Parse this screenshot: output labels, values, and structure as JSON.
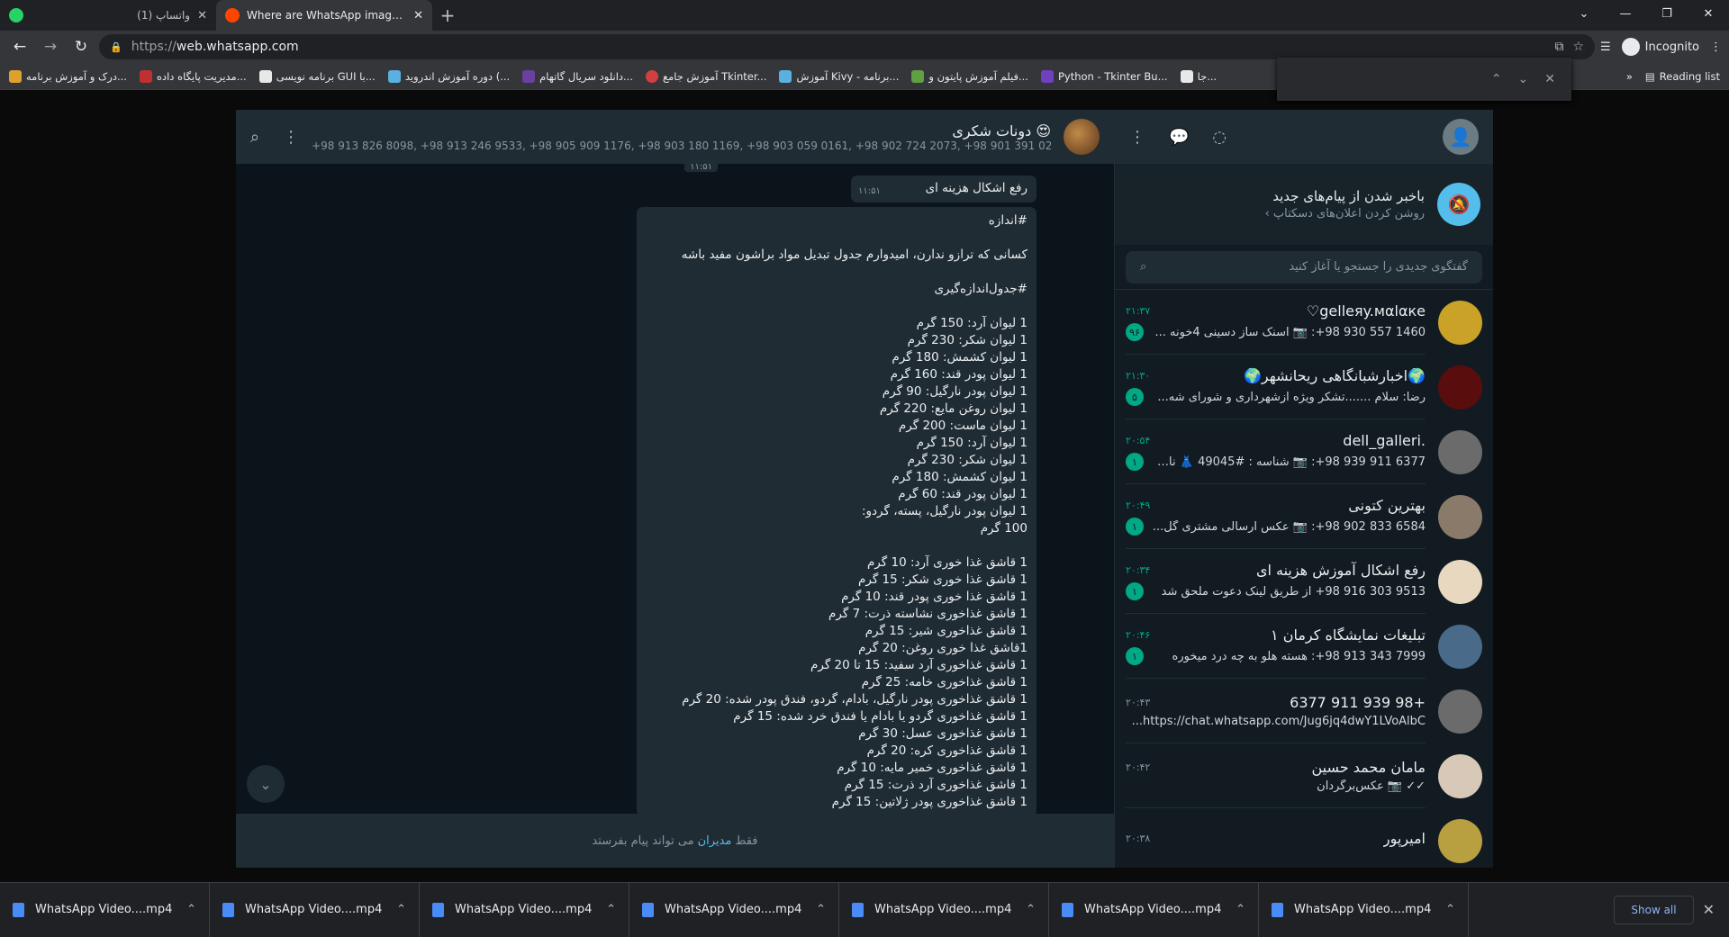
{
  "browser": {
    "tabs": [
      {
        "title": "(1) واتساپ",
        "active": false
      },
      {
        "title": "Where are WhatsApp images and",
        "active": true
      }
    ],
    "url_scheme": "https://",
    "url_host": "web.whatsapp.com",
    "incognito_label": "Incognito",
    "reading_list": "Reading list",
    "bookmarks": [
      "درک و آموزش برنامه...",
      "مدیریت پایگاه داده...",
      "برنامه نویسی GUI با...",
      "دوره آموزش اندروید (...",
      "دانلود سریال گاتهام...",
      "آموزش جامع Tkinter...",
      "آموزش Kivy - برنامه...",
      "فیلم آموزش پایتون و...",
      "Python - Tkinter Bu...",
      "جا..."
    ]
  },
  "chat": {
    "name": "دونات شکری 😍",
    "members": "+98 913 826 8098, +98 913 246 9533, +98 905 909 1176, +98 903 180 1169, +98 903 059 0161, +98 902 724 2073, +98 901 391 0298, ...",
    "top_stamp": "۱۱:۵۱",
    "msg1_text": "رفع اشکال هزینه ای",
    "msg1_time": "۱۱:۵۱",
    "msg2_text": "#اندازه\n\nکسانی که ترازو ندارن، امیدوارم جدول تبدیل مواد براشون مفید باشه\n\n#جدول‌اندازه‌گیری\n\n1 لیوان آرد: 150 گرم\n1 لیوان شکر: 230 گرم\n1 لیوان کشمش: 180 گرم\n1 لیوان پودر قند: 160 گرم\n1 لیوان پودر نارگیل: 90 گرم\n1 لیوان روغن مایع: 220 گرم\n1 لیوان ماست: 200 گرم\n1 لیوان آرد: 150 گرم\n1 لیوان شکر: 230 گرم\n1 لیوان کشمش: 180 گرم\n1 لیوان پودر قند: 60 گرم\n1 لیوان پودر نارگیل، پسته، گردو:\n100 گرم\n\n1 قاشق غذا خوری آرد: 10 گرم\n1 قاشق غذا خوری شکر: 15 گرم\n1 قاشق غذا خوری پودر قند: 10 گرم\n1 قاشق غذاخوری نشاسته ذرت: 7 گرم\n1 قاشق غذاخوری شیر: 15 گرم\n1قاشق غذا خوری روغن: 20 گرم\n1 قاشق غذاخوری آرد سفید: 15 تا 20 گرم\n1 قاشق غذاخوری خامه: 25 گرم\n1 قاشق غذاخوری پودر نارگیل، بادام، گردو، فندق پودر شده: 20 گرم\n1 قاشق غذاخوری گردو یا بادام یا فندق خرد شده: 15 گرم\n1 قاشق غذاخوری عسل: 30 گرم\n1 قاشق غذاخوری کره: 20 گرم\n1 قاشق غذاخوری خمیر مایه: 10 گرم\n1 قاشق غذاخوری آرد ذرت: 15 گرم\n1 قاشق غذاخوری پودر ژلاتین: 15 گرم",
    "footer_prefix": "فقط",
    "footer_link": "مدیران",
    "footer_suffix": "می تواند پیام بفرستد"
  },
  "sidebar": {
    "notif_title": "باخبر شدن از پیام‌های جدید",
    "notif_sub": "روشن کردن اعلان‌های دسکتاپ ›",
    "search_placeholder": "گفتگوی جدیدی را جستجو یا آغاز کنید",
    "chats": [
      {
        "name": "gelleяy.мαlαкe♡",
        "time": "۲۱:۳۷",
        "preview": "‎+98 930 557 1460: 📷 اسنک ساز دسینی 4خونه ...",
        "badge": "۹۶",
        "color": "#c9a227"
      },
      {
        "name": "🌍اخبارشبانگاهی ریحانشهر🌍",
        "time": "۲۱:۳۰",
        "preview": "رضا: سلام .......تشکر ویژه ازشهرداری و  شورای شه...",
        "badge": "۵",
        "color": "#5a0d0d"
      },
      {
        "name": ".dell_galleri",
        "time": "۲۰:۵۴",
        "preview": "‎+98 939 911 6377: 📷 شناسه : #49045 👗 نام :...",
        "badge": "۱",
        "color": "#6b6b6b"
      },
      {
        "name": "بهترین کتونی",
        "time": "۲۰:۴۹",
        "preview": "‎+98 902 833 6584: 📷 عکس ارسالی مشتری گل...",
        "badge": "۱",
        "color": "#8a7a6a"
      },
      {
        "name": "رفع اشکال آموزش هزینه ای",
        "time": "۲۰:۳۴",
        "preview": "‎+98 916 303 9513 از طریق لینک دعوت ملحق شد",
        "badge": "۱",
        "color": "#e8d8c0"
      },
      {
        "name": "تبلیغات نمایشگاه کرمان ۱",
        "time": "۲۰:۴۶",
        "preview": "‎+98 913 343 7999: هسته هلو به چه درد میخوره",
        "badge": "۱",
        "color": "#4a6a8a"
      },
      {
        "name": "+98 939 911 6377",
        "time": "۲۰:۴۳",
        "preview": "https://chat.whatsapp.com/Jug6jq4dwY1LVoAlbC...",
        "badge": "",
        "color": "#6b6b6b"
      },
      {
        "name": "مامان محمد حسین",
        "time": "۲۰:۴۲",
        "preview": "✓✓ 📷 عکس‌برگردان",
        "badge": "",
        "color": "#d8c8b8"
      },
      {
        "name": "امیرپور",
        "time": "۲۰:۳۸",
        "preview": "",
        "badge": "",
        "color": "#b8a040"
      }
    ]
  },
  "downloads": {
    "items": [
      "WhatsApp Video....mp4",
      "WhatsApp Video....mp4",
      "WhatsApp Video....mp4",
      "WhatsApp Video....mp4",
      "WhatsApp Video....mp4",
      "WhatsApp Video....mp4",
      "WhatsApp Video....mp4"
    ],
    "show_all": "Show all"
  }
}
